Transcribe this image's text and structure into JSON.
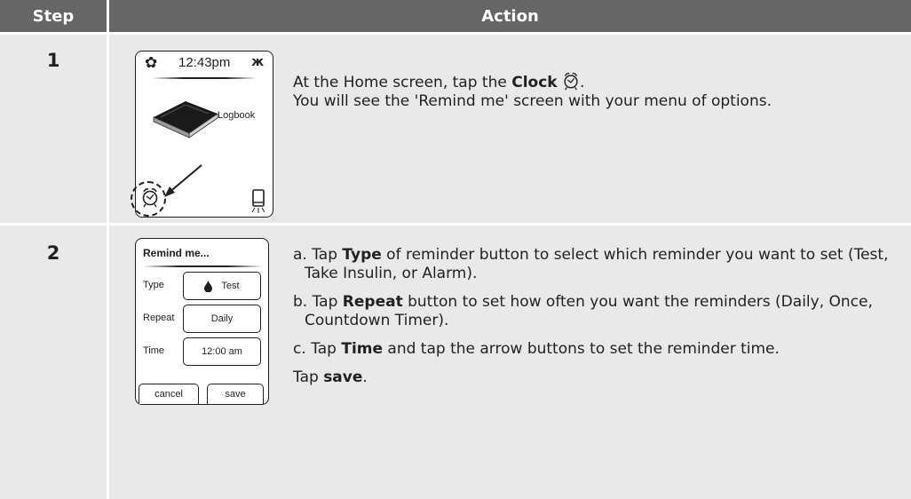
{
  "header": {
    "step": "Step",
    "action": "Action"
  },
  "rows": [
    {
      "step": "1",
      "screen": {
        "time": "12:43pm",
        "book_label": "Logbook"
      },
      "lines": [
        {
          "pre": "At the Home screen, tap the ",
          "bold": "Clock",
          "post": "."
        },
        {
          "text": "You will see the 'Remind me' screen with your menu of options."
        }
      ]
    },
    {
      "step": "2",
      "screen": {
        "title": "Remind me...",
        "fields": [
          {
            "label": "Type",
            "value": "Test"
          },
          {
            "label": "Repeat",
            "value": "Daily"
          },
          {
            "label": "Time",
            "value": "12:00 am"
          }
        ],
        "cancel": "cancel",
        "save": "save"
      },
      "items": [
        {
          "pre": "a. Tap ",
          "bold": "Type",
          "post": " of reminder button to select which reminder you want to set (Test, Take Insulin, or Alarm)."
        },
        {
          "pre": "b. Tap ",
          "bold": "Repeat",
          "post": " button to set how often you want the reminders (Daily, Once, Countdown Timer)."
        },
        {
          "pre": "c. Tap ",
          "bold": "Time",
          "post": " and tap the arrow buttons to set the reminder time."
        },
        {
          "pre": "Tap ",
          "bold": "save",
          "post": "."
        }
      ]
    }
  ]
}
